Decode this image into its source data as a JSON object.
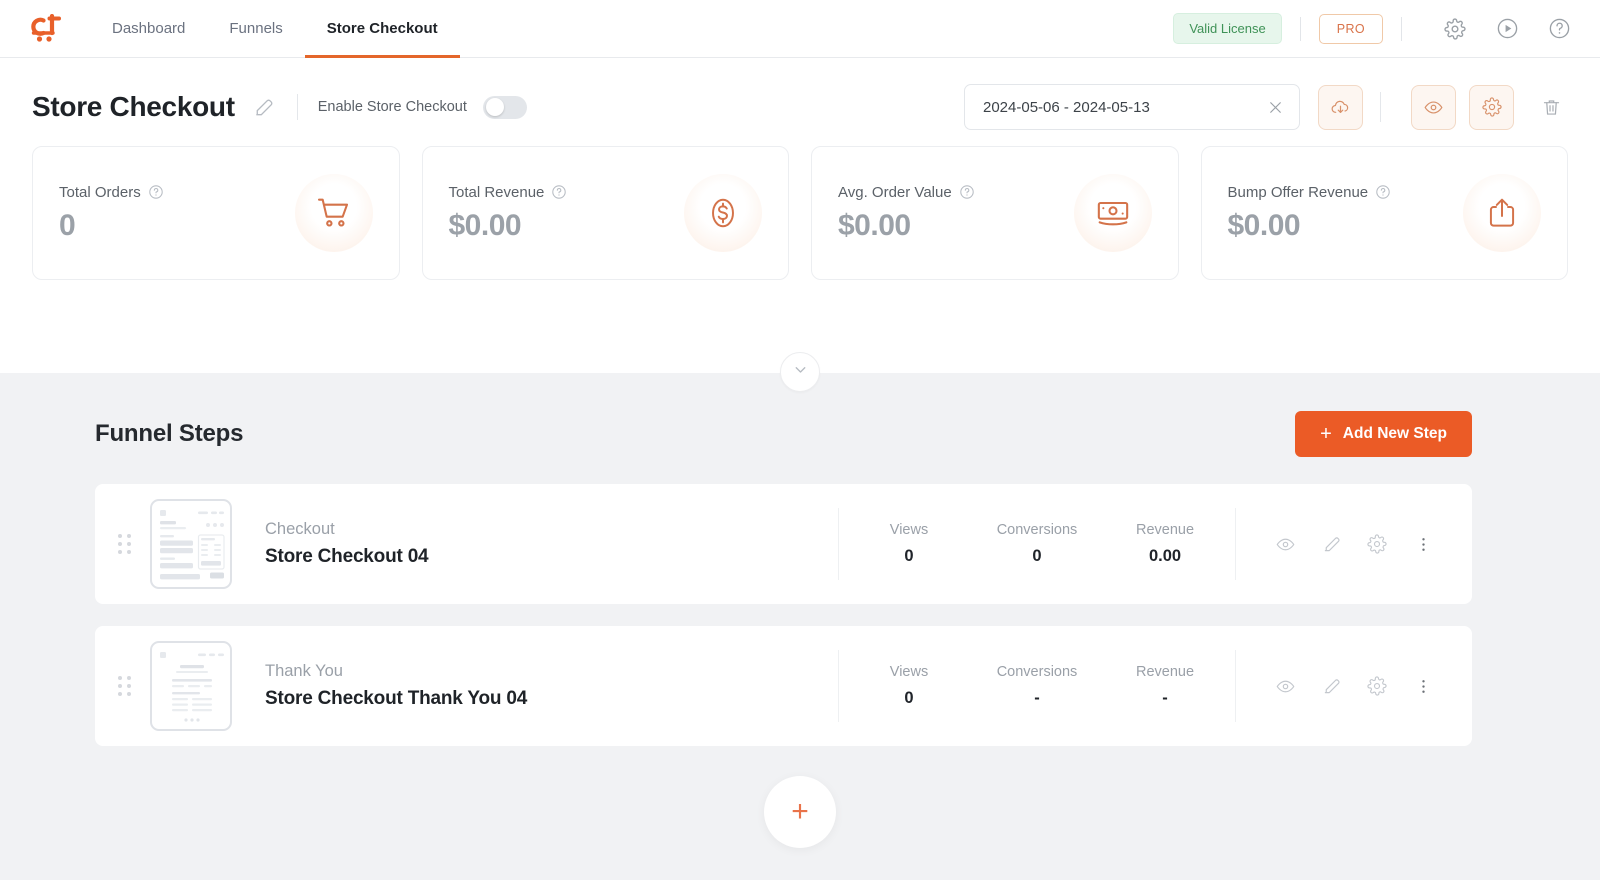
{
  "nav": {
    "logo_alt": "cartflows-logo",
    "items": [
      {
        "label": "Dashboard",
        "active": false
      },
      {
        "label": "Funnels",
        "active": false
      },
      {
        "label": "Store Checkout",
        "active": true
      }
    ],
    "license_badge": "Valid License",
    "pro_badge": "PRO",
    "icons": [
      "gear-icon",
      "play-circle-icon",
      "help-circle-icon"
    ]
  },
  "header": {
    "title": "Store Checkout",
    "edit_icon": "edit-pencil-icon",
    "enable_label": "Enable Store Checkout",
    "toggle_on": false,
    "date_range": "2024-05-06 - 2024-05-13",
    "date_clear_icon": "close-icon",
    "actions": [
      {
        "name": "import-export-button",
        "icon": "cloud-download-icon"
      },
      {
        "name": "preview-button",
        "icon": "eye-icon"
      },
      {
        "name": "settings-button",
        "icon": "gear-icon"
      }
    ],
    "delete_icon": "trash-icon"
  },
  "stats": [
    {
      "label": "Total Orders",
      "value": "0",
      "icon": "shopping-cart-icon",
      "help": "?"
    },
    {
      "label": "Total Revenue",
      "value": "$0.00",
      "icon": "dollar-circle-icon",
      "help": "?"
    },
    {
      "label": "Avg. Order Value",
      "value": "$0.00",
      "icon": "banknote-icon",
      "help": "?"
    },
    {
      "label": "Bump Offer Revenue",
      "value": "$0.00",
      "icon": "share-upload-icon",
      "help": "?"
    }
  ],
  "collapse": {
    "icon": "chevron-down-icon"
  },
  "funnel": {
    "section_title": "Funnel Steps",
    "add_button": "Add New Step",
    "add_button_plus": "+",
    "metric_headers": [
      "Views",
      "Conversions",
      "Revenue"
    ],
    "steps": [
      {
        "type": "Checkout",
        "name": "Store Checkout 04",
        "views": "0",
        "conversions": "0",
        "revenue": "0.00",
        "thumb": "checkout-page-thumbnail"
      },
      {
        "type": "Thank You",
        "name": "Store Checkout Thank You 04",
        "views": "0",
        "conversions": "-",
        "revenue": "-",
        "thumb": "thankyou-page-thumbnail"
      }
    ],
    "add_fab_label": "+"
  },
  "colors": {
    "accent": "#eb5b26",
    "accent_soft": "#d4734a",
    "license_green": "#3f9257",
    "gray_bg": "#f1f2f4",
    "text_dark": "#1f2328",
    "text_muted": "#9aa0a8"
  }
}
